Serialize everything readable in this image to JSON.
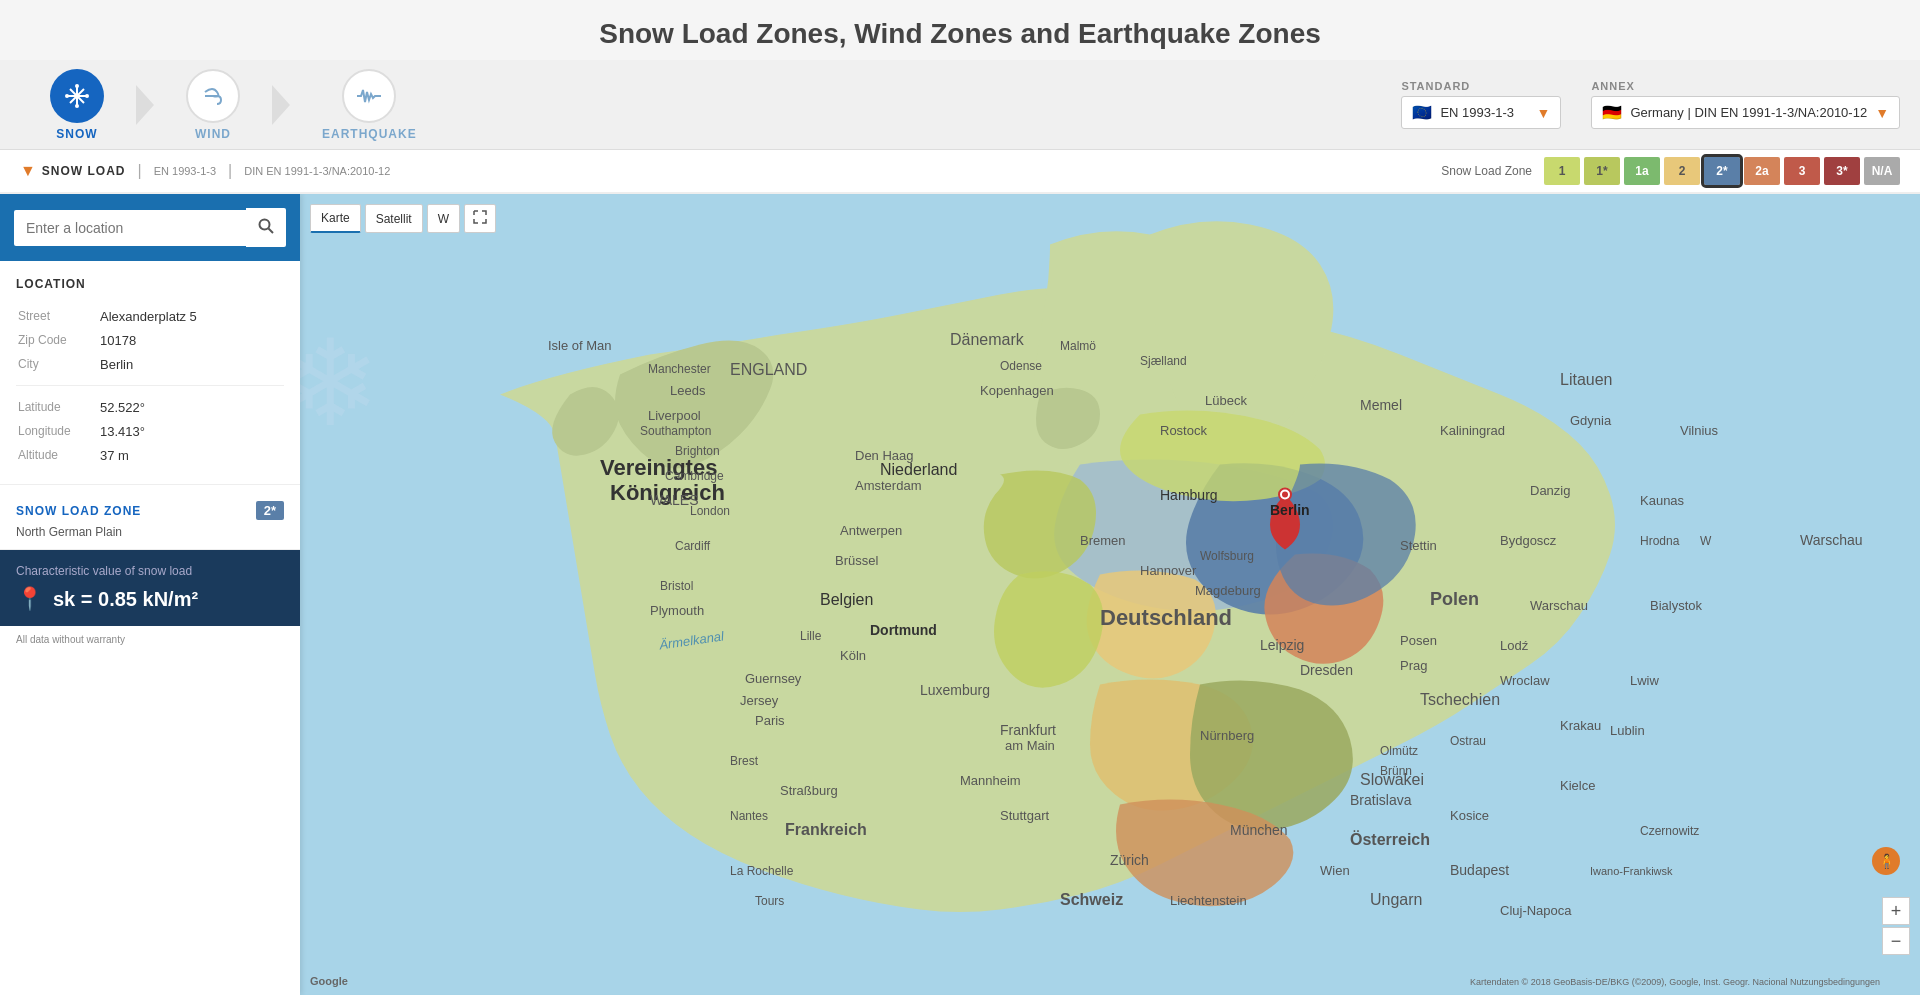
{
  "page": {
    "title": "Snow Load Zones, Wind Zones and Earthquake Zones"
  },
  "nav": {
    "tabs": [
      {
        "id": "snow",
        "label": "SNOW",
        "active": true,
        "icon": "❄"
      },
      {
        "id": "wind",
        "label": "WIND",
        "active": false,
        "icon": "💨"
      },
      {
        "id": "earthquake",
        "label": "EARTHQUAKE",
        "active": false,
        "icon": "📊"
      }
    ]
  },
  "standard": {
    "label": "STANDARD",
    "value": "EN 1993-1-3",
    "flag": "🇪🇺"
  },
  "annex": {
    "label": "ANNEX",
    "value": "Germany | DIN EN 1991-1-3/NA:2010-12",
    "flag": "🇩🇪"
  },
  "zone_bar": {
    "badge": "SNOW LOAD",
    "standard": "EN 1993-1-3",
    "annex": "DIN EN 1991-1-3/NA:2010-12",
    "legend_label": "Snow Load Zone",
    "zones": [
      {
        "label": "1",
        "color": "#c8d96e"
      },
      {
        "label": "1*",
        "color": "#b8c85e"
      },
      {
        "label": "1a",
        "color": "#7cba6e"
      },
      {
        "label": "2",
        "color": "#e8c87a"
      },
      {
        "label": "2*",
        "color": "#5a7fa8",
        "active": true
      },
      {
        "label": "2a",
        "color": "#d4845a"
      },
      {
        "label": "3",
        "color": "#c05a4a"
      },
      {
        "label": "3*",
        "color": "#a04040"
      },
      {
        "label": "N/A",
        "color": "#aaaaaa"
      }
    ]
  },
  "search": {
    "placeholder": "Enter a location"
  },
  "location": {
    "section_title": "LOCATION",
    "street_label": "Street",
    "street_value": "Alexanderplatz 5",
    "zip_label": "Zip Code",
    "zip_value": "10178",
    "city_label": "City",
    "city_value": "Berlin",
    "lat_label": "Latitude",
    "lat_value": "52.522°",
    "lng_label": "Longitude",
    "lng_value": "13.413°",
    "alt_label": "Altitude",
    "alt_value": "37 m"
  },
  "snow_zone": {
    "title": "SNOW LOAD ZONE",
    "value": "2*",
    "name": "North German Plain"
  },
  "snow_load_result": {
    "label": "Characteristic value of snow load",
    "formula": "sk = 0.85 kN/m²"
  },
  "warranty": {
    "text": "All data without warranty"
  },
  "map": {
    "controls": [
      "Karte",
      "Satellit",
      "W"
    ],
    "zoom_plus": "+",
    "zoom_minus": "−",
    "attribution": "Kartendaten © 2018 GeoBasis-DE/BKG (©2009), Google, Inst. Geogr. Nacional   Nutzungsbedingungen"
  }
}
